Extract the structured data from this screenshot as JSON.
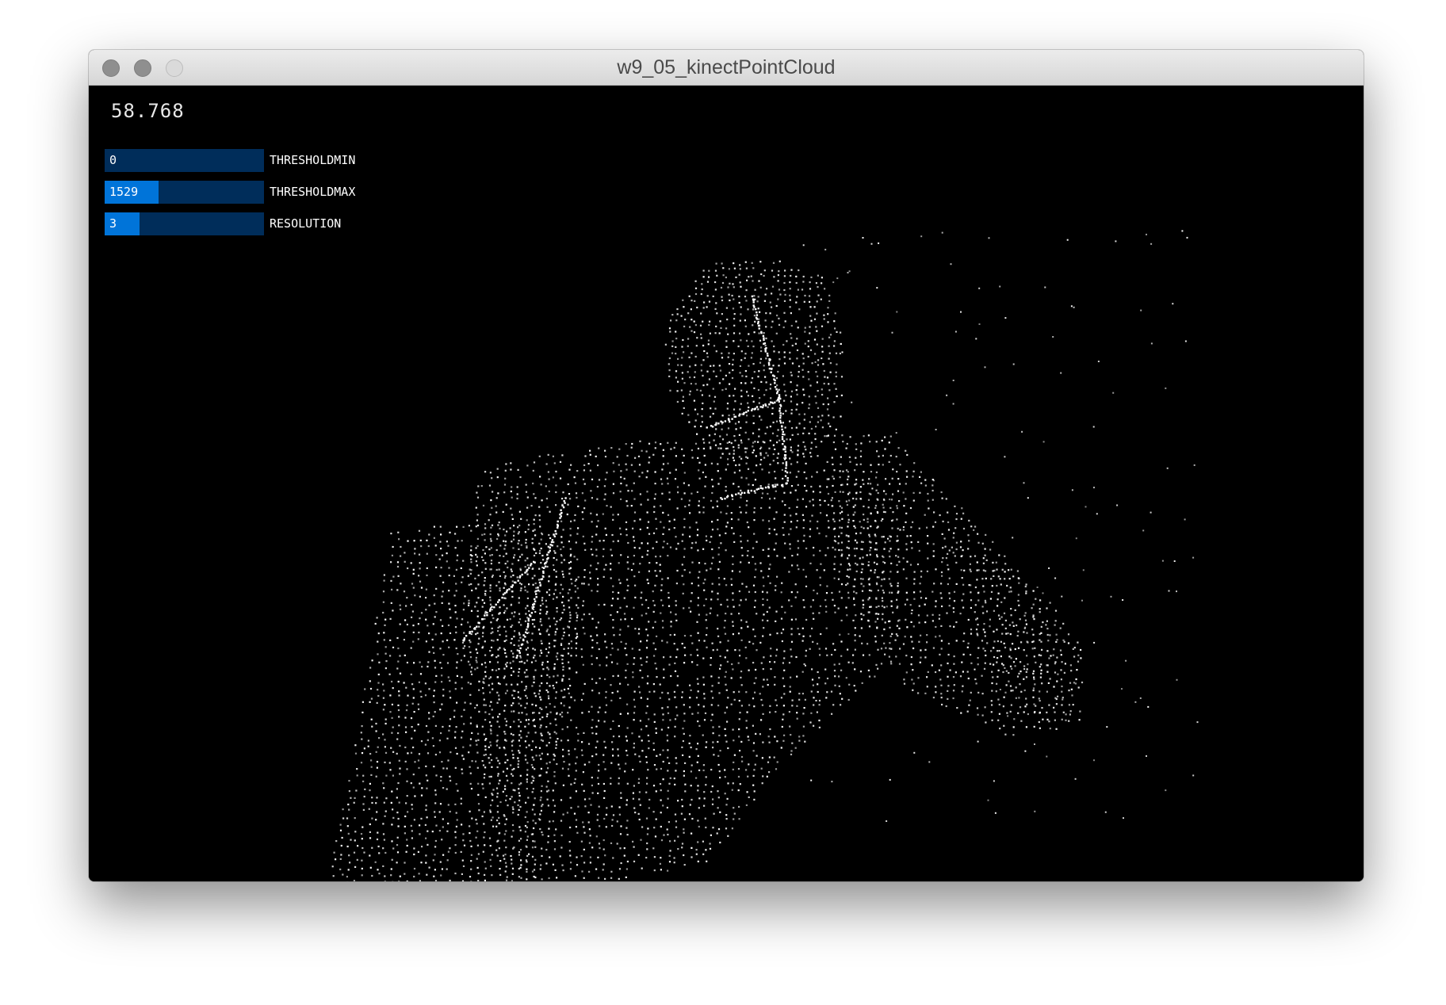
{
  "window": {
    "title": "w9_05_kinectPointCloud"
  },
  "hud": {
    "fps": "58.768"
  },
  "sliders": [
    {
      "value": "0",
      "label": "THRESHOLDMIN",
      "fill": 0.0
    },
    {
      "value": "1529",
      "label": "THRESHOLDMAX",
      "fill": 0.34
    },
    {
      "value": "3",
      "label": "RESOLUTION",
      "fill": 0.22
    }
  ],
  "colors": {
    "slider_bg": "#002d5a",
    "slider_fill": "#0074d9",
    "canvas_bg": "#000000",
    "points": "#ffffff"
  }
}
